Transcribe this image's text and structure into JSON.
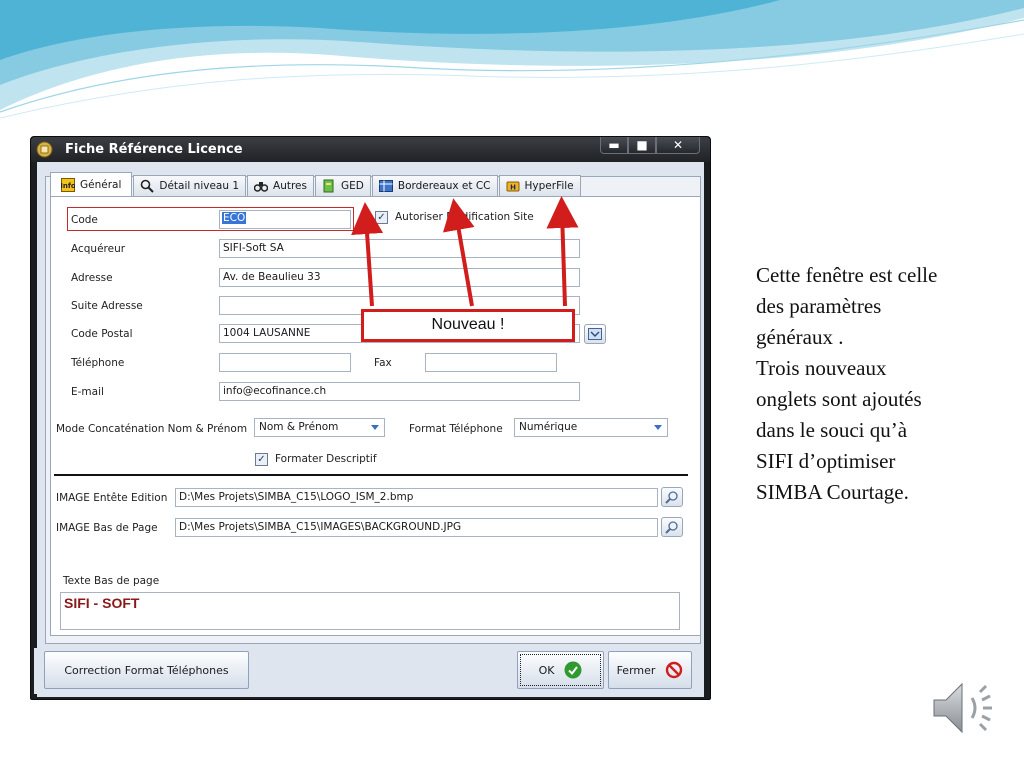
{
  "window": {
    "title": "Fiche Référence Licence",
    "controls": {
      "minimize": "▬",
      "maximize": "■",
      "close": "✕"
    }
  },
  "tabs": [
    {
      "label": "Général",
      "icon": "info-icon",
      "active": true
    },
    {
      "label": "Détail niveau 1",
      "icon": "magnifier-icon"
    },
    {
      "label": "Autres",
      "icon": "binoculars-icon"
    },
    {
      "label": "GED",
      "icon": "ged-icon"
    },
    {
      "label": "Bordereaux et CC",
      "icon": "grid-icon"
    },
    {
      "label": "HyperFile",
      "icon": "hyperfile-icon"
    }
  ],
  "form": {
    "code": {
      "label": "Code",
      "value": "ECO"
    },
    "autoriser": {
      "label": "Autoriser Modification Site",
      "checked": true
    },
    "acquereur": {
      "label": "Acquéreur",
      "value": "SIFI-Soft SA"
    },
    "adresse": {
      "label": "Adresse",
      "value": "Av. de Beaulieu 33"
    },
    "suite": {
      "label": "Suite Adresse",
      "value": ""
    },
    "code_postal": {
      "label": "Code Postal",
      "value": "1004 LAUSANNE"
    },
    "telephone": {
      "label": "Téléphone",
      "value": ""
    },
    "fax": {
      "label": "Fax",
      "value": ""
    },
    "email": {
      "label": "E-mail",
      "value": "info@ecofinance.ch"
    },
    "mode_concat": {
      "label": "Mode Concaténation Nom & Prénom",
      "value": "Nom & Prénom"
    },
    "format_tel": {
      "label": "Format Téléphone",
      "value": "Numérique"
    },
    "formater": {
      "label": "Formater Descriptif",
      "checked": true
    },
    "image_entete": {
      "label": "IMAGE Entête Edition",
      "value": "D:\\Mes Projets\\SIMBA_C15\\LOGO_ISM_2.bmp"
    },
    "image_bas": {
      "label": "IMAGE Bas de Page",
      "value": "D:\\Mes Projets\\SIMBA_C15\\IMAGES\\BACKGROUND.JPG"
    },
    "texte_bas": {
      "label": "Texte Bas de page",
      "value": "SIFI - SOFT"
    }
  },
  "buttons": {
    "correction": "Correction Format Téléphones",
    "ok": "OK",
    "fermer": "Fermer"
  },
  "callout": {
    "text": "Nouveau !"
  },
  "note": {
    "lines": [
      "Cette fenêtre est celle",
      "des paramètres",
      "généraux .",
      "Trois nouveaux",
      "onglets sont ajoutés",
      "dans le souci qu’à",
      "SIFI d’optimiser",
      "SIMBA Courtage."
    ]
  },
  "colors": {
    "accent_red": "#d21d1d",
    "ok_green": "#2f9a2f",
    "title_bar": "#2b2e33",
    "slide_wave": "#7cc6df"
  }
}
